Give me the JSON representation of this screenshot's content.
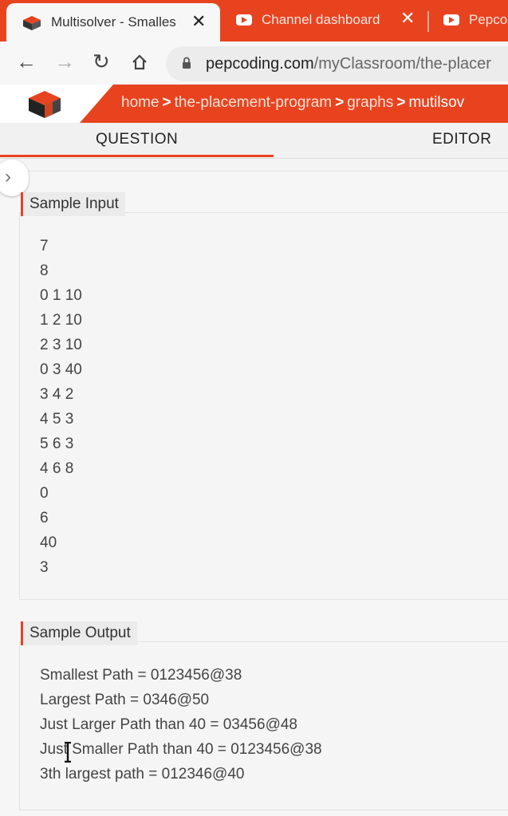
{
  "browser": {
    "tabs": [
      {
        "title": "Multisolver - Smalles",
        "active": true,
        "close": "✕"
      },
      {
        "title": "Channel dashboard",
        "active": false,
        "close": "✕"
      },
      {
        "title": "Pepco",
        "active": false
      }
    ],
    "url_host": "pepcoding.com",
    "url_path": "/myClassroom/the-placer"
  },
  "site": {
    "breadcrumb": [
      {
        "label": "home"
      },
      {
        "label": "the-placement-program"
      },
      {
        "label": "graphs"
      },
      {
        "label": "mutilsov"
      }
    ]
  },
  "question_tabs": [
    {
      "label": "QUESTION",
      "active": true
    },
    {
      "label": "EDITOR",
      "active": false
    }
  ],
  "sample_input": {
    "heading": "Sample Input",
    "lines": [
      "7",
      "8",
      "0 1 10",
      "1 2 10",
      "2 3 10",
      "0 3 40",
      "3 4 2",
      "4 5 3",
      "5 6 3",
      "4 6 8",
      "0",
      "6",
      "40",
      "3"
    ]
  },
  "sample_output": {
    "heading": "Sample Output",
    "lines": [
      "Smallest Path = 0123456@38",
      "Largest Path = 0346@50",
      "Just Larger Path than 40 = 03456@48",
      "Just Smaller Path than 40 = 0123456@38",
      "3th largest path = 012346@40"
    ]
  },
  "colors": {
    "accent": "#e8431f"
  }
}
